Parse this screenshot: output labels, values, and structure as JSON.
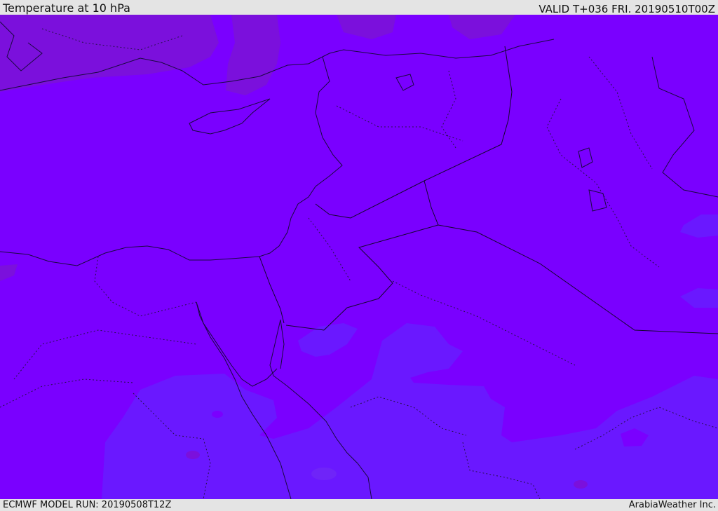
{
  "header": {
    "title": "Temperature at 10 hPa",
    "valid": "VALID T+036 FRI. 20190510T00Z"
  },
  "footer": {
    "model_run": "ECMWF MODEL RUN: 20190508T12Z",
    "credit": "ArabiaWeather Inc."
  },
  "map": {
    "colors": {
      "base_field": "#7a00ff",
      "warm_patch": "#7b10dc",
      "cool_patch": "#6a18ff",
      "small_cool": "#6f24f8",
      "coast_line": "#1a0840",
      "border_line": "#150630"
    }
  }
}
